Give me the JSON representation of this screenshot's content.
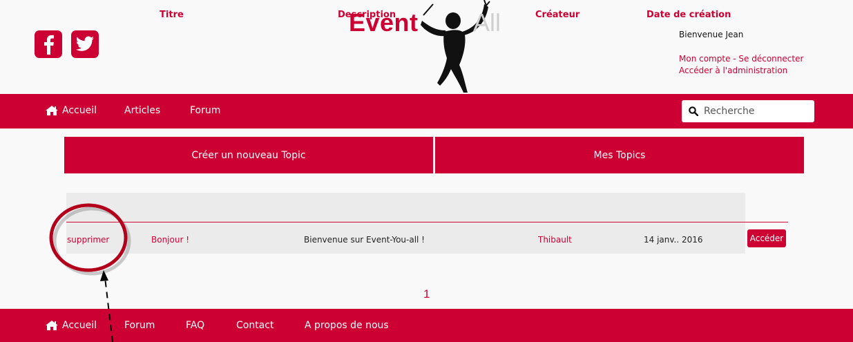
{
  "header": {
    "logo": {
      "event": "Event",
      "all": "All"
    },
    "social": [
      {
        "icon": "facebook-icon"
      },
      {
        "icon": "twitter-icon"
      }
    ],
    "user": {
      "welcome": "Bienvenue Jean",
      "my_account": "Mon compte",
      "separator": " - ",
      "logout": "Se déconnecter",
      "admin": "Accéder à l'administration"
    }
  },
  "nav": {
    "items": [
      {
        "label": "Accueil",
        "icon": "home-icon"
      },
      {
        "label": "Articles"
      },
      {
        "label": "Forum"
      }
    ],
    "search": {
      "placeholder": "Recherche",
      "icon": "search-icon"
    }
  },
  "actions": {
    "create": "Créer un nouveau Topic",
    "my_topics": "Mes Topics"
  },
  "table": {
    "headers": [
      "Titre",
      "Description",
      "Créateur",
      "Date de création"
    ],
    "rows": [
      {
        "delete": "supprimer",
        "title": "Bonjour !",
        "description": "Bienvenue sur Event-You-all !",
        "creator": "Thibault",
        "date": "14 janv.. 2016",
        "access": "Accéder"
      }
    ]
  },
  "pagination": {
    "current": "1"
  },
  "footer": {
    "items": [
      {
        "label": "Accueil",
        "icon": "home-icon"
      },
      {
        "label": "Forum"
      },
      {
        "label": "FAQ"
      },
      {
        "label": "Contact"
      },
      {
        "label": "A propos de nous"
      }
    ]
  },
  "colors": {
    "brand": "#cc0033",
    "background": "#f9f9f9",
    "table_bg": "#ebebeb"
  }
}
